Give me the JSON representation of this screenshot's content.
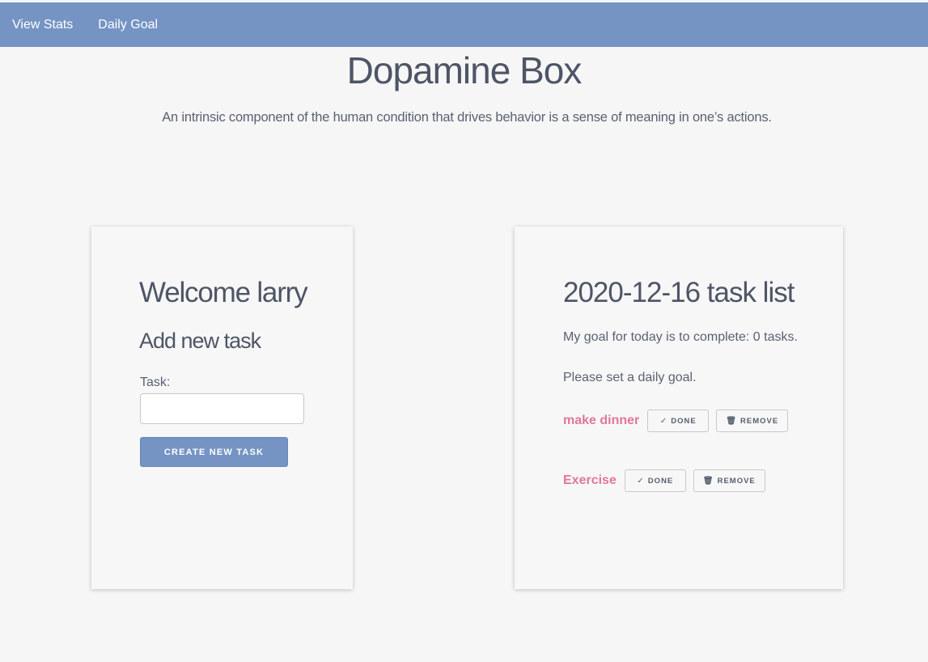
{
  "nav": {
    "items": [
      {
        "label": "View Stats"
      },
      {
        "label": "Daily Goal"
      }
    ]
  },
  "header": {
    "title": "Dopamine Box",
    "subtitle": "An intrinsic component of the human condition that drives behavior is a sense of meaning in one’s actions."
  },
  "left_card": {
    "welcome": "Welcome larry",
    "add_heading": "Add new task",
    "task_label": "Task:",
    "task_input_value": "",
    "task_input_placeholder": "",
    "create_button_label": "CREATE NEW TASK"
  },
  "right_card": {
    "heading": "2020-12-16 task list",
    "goal_text": "My goal for today is to complete: 0 tasks.",
    "set_goal_text": "Please set a daily goal.",
    "tasks": [
      {
        "name": "make dinner",
        "done_label": "DONE",
        "remove_label": "REMOVE"
      },
      {
        "name": "Exercise",
        "done_label": "DONE",
        "remove_label": "REMOVE"
      }
    ]
  },
  "colors": {
    "nav_bg": "#7594c4",
    "page_bg": "#f6f6f6",
    "task_name": "#e0779c",
    "primary_button": "#7594c4"
  },
  "icons": {
    "done": "check-icon",
    "remove": "trash-icon"
  }
}
